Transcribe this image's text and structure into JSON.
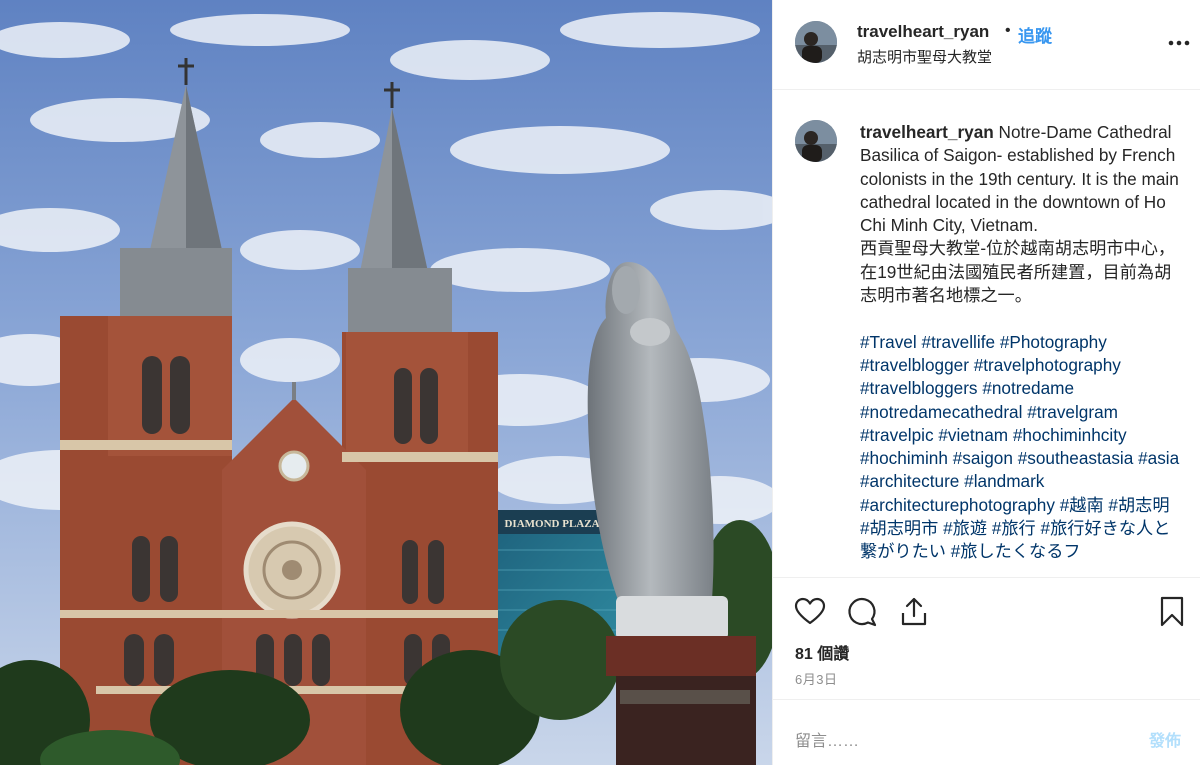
{
  "post": {
    "username": "travelheart_ryan",
    "separator": "•",
    "follow_label": "追蹤",
    "location": "胡志明市聖母大教堂",
    "more_icon": "more-options-icon"
  },
  "caption": {
    "username": "travelheart_ryan",
    "english": "Notre-Dame Cathedral Basilica of Saigon- established by French colonists in the 19th century. It is the main cathedral located in the downtown of Ho Chi Minh City, Vietnam.",
    "chinese": "西貢聖母大教堂-位於越南胡志明市中心，在19世紀由法國殖民者所建置，目前為胡志明市著名地標之一。",
    "hashtags": [
      "#Travel",
      "#travellife",
      "#Photography",
      "#travelblogger",
      "#travelphotography",
      "#travelbloggers",
      "#notredame",
      "#notredamecathedral",
      "#travelgram",
      "#travelpic",
      "#vietnam",
      "#hochiminhcity",
      "#hochiminh",
      "#saigon",
      "#southeastasia",
      "#asia",
      "#architecture",
      "#landmark",
      "#architecturephotography",
      "#越南",
      "#胡志明",
      "#胡志明市",
      "#旅遊",
      "#旅行",
      "#旅行好きな人と繋がりたい",
      "#旅したくなるフ"
    ]
  },
  "photo": {
    "building_sign": "DIAMOND PLAZA",
    "colors": {
      "sky": "#6f93cc",
      "brick": "#9a4a32",
      "stone": "#8f959b"
    }
  },
  "actions": {
    "icons": [
      "heart-icon",
      "comment-icon",
      "share-icon",
      "bookmark-icon"
    ],
    "likes": "81 個讚",
    "date": "6月3日"
  },
  "comment_box": {
    "placeholder": "留言……",
    "post_label": "發佈"
  },
  "colors": {
    "link": "#3897f0",
    "hashtag": "#003569",
    "muted": "#8e8e8e"
  }
}
